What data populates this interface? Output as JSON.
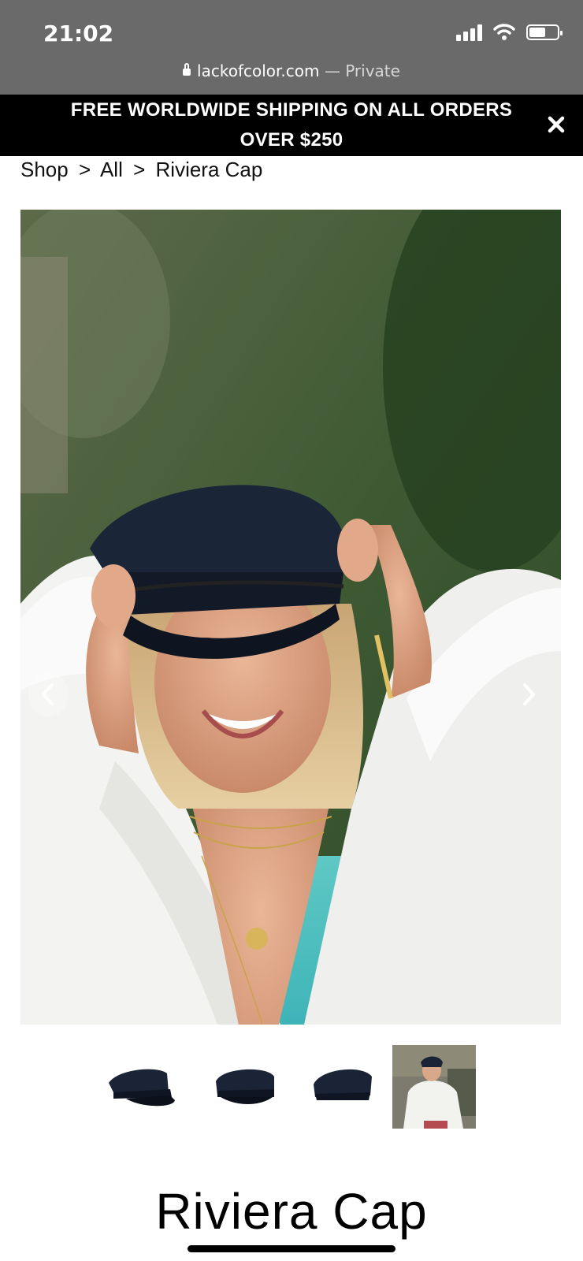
{
  "status_bar": {
    "time": "21:02"
  },
  "browser": {
    "domain": "lackofcolor.com",
    "mode": " — Private"
  },
  "banner": {
    "text": "FREE WORLDWIDE SHIPPING ON ALL ORDERS OVER $250"
  },
  "breadcrumb": {
    "items": [
      "Shop",
      ">",
      "All",
      ">",
      "Riviera Cap"
    ]
  },
  "product": {
    "title": "Riviera Cap"
  },
  "colors": {
    "banner_bg": "#000000",
    "status_bar_bg": "#6a6a6a"
  }
}
